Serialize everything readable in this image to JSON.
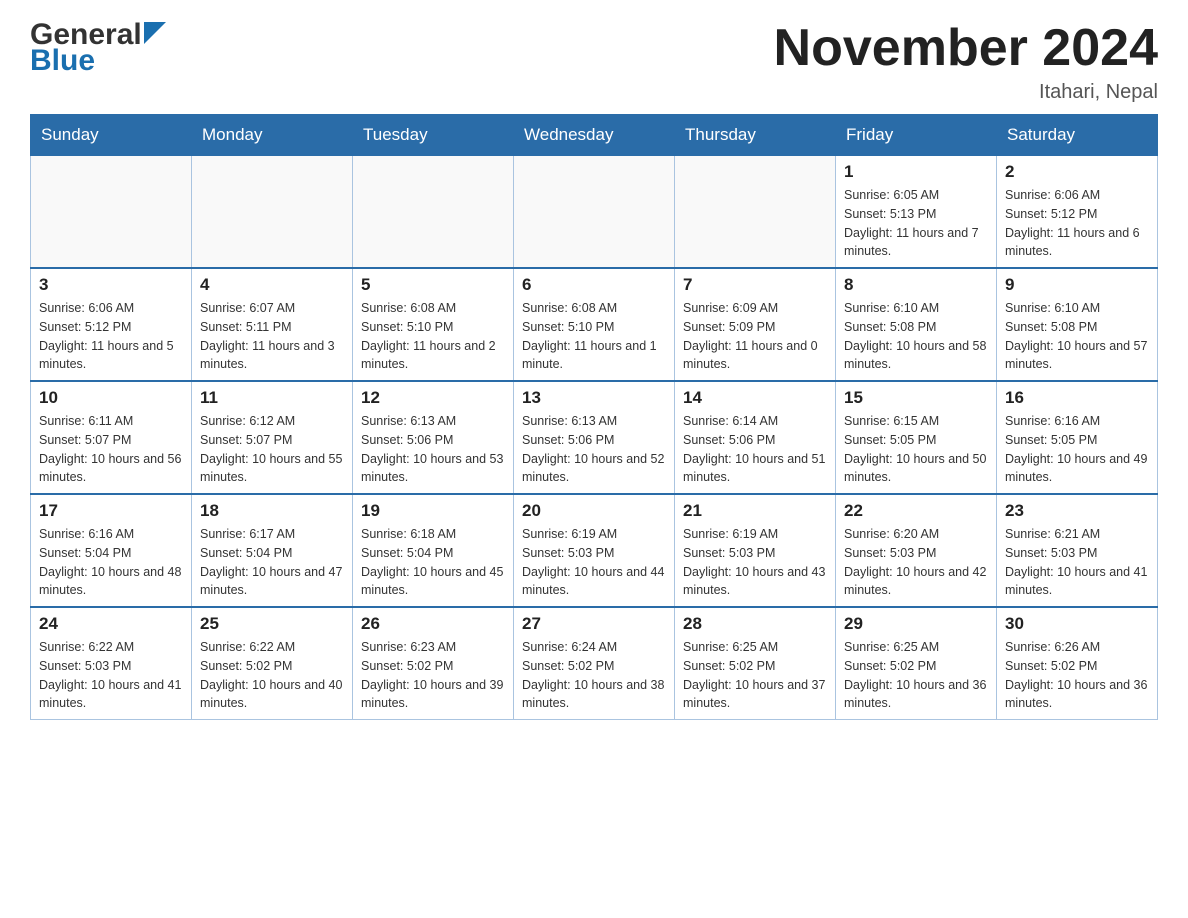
{
  "header": {
    "logo_general": "General",
    "logo_blue": "Blue",
    "month_title": "November 2024",
    "location": "Itahari, Nepal"
  },
  "days_of_week": [
    "Sunday",
    "Monday",
    "Tuesday",
    "Wednesday",
    "Thursday",
    "Friday",
    "Saturday"
  ],
  "weeks": [
    [
      {
        "day": "",
        "info": ""
      },
      {
        "day": "",
        "info": ""
      },
      {
        "day": "",
        "info": ""
      },
      {
        "day": "",
        "info": ""
      },
      {
        "day": "",
        "info": ""
      },
      {
        "day": "1",
        "info": "Sunrise: 6:05 AM\nSunset: 5:13 PM\nDaylight: 11 hours and 7 minutes."
      },
      {
        "day": "2",
        "info": "Sunrise: 6:06 AM\nSunset: 5:12 PM\nDaylight: 11 hours and 6 minutes."
      }
    ],
    [
      {
        "day": "3",
        "info": "Sunrise: 6:06 AM\nSunset: 5:12 PM\nDaylight: 11 hours and 5 minutes."
      },
      {
        "day": "4",
        "info": "Sunrise: 6:07 AM\nSunset: 5:11 PM\nDaylight: 11 hours and 3 minutes."
      },
      {
        "day": "5",
        "info": "Sunrise: 6:08 AM\nSunset: 5:10 PM\nDaylight: 11 hours and 2 minutes."
      },
      {
        "day": "6",
        "info": "Sunrise: 6:08 AM\nSunset: 5:10 PM\nDaylight: 11 hours and 1 minute."
      },
      {
        "day": "7",
        "info": "Sunrise: 6:09 AM\nSunset: 5:09 PM\nDaylight: 11 hours and 0 minutes."
      },
      {
        "day": "8",
        "info": "Sunrise: 6:10 AM\nSunset: 5:08 PM\nDaylight: 10 hours and 58 minutes."
      },
      {
        "day": "9",
        "info": "Sunrise: 6:10 AM\nSunset: 5:08 PM\nDaylight: 10 hours and 57 minutes."
      }
    ],
    [
      {
        "day": "10",
        "info": "Sunrise: 6:11 AM\nSunset: 5:07 PM\nDaylight: 10 hours and 56 minutes."
      },
      {
        "day": "11",
        "info": "Sunrise: 6:12 AM\nSunset: 5:07 PM\nDaylight: 10 hours and 55 minutes."
      },
      {
        "day": "12",
        "info": "Sunrise: 6:13 AM\nSunset: 5:06 PM\nDaylight: 10 hours and 53 minutes."
      },
      {
        "day": "13",
        "info": "Sunrise: 6:13 AM\nSunset: 5:06 PM\nDaylight: 10 hours and 52 minutes."
      },
      {
        "day": "14",
        "info": "Sunrise: 6:14 AM\nSunset: 5:06 PM\nDaylight: 10 hours and 51 minutes."
      },
      {
        "day": "15",
        "info": "Sunrise: 6:15 AM\nSunset: 5:05 PM\nDaylight: 10 hours and 50 minutes."
      },
      {
        "day": "16",
        "info": "Sunrise: 6:16 AM\nSunset: 5:05 PM\nDaylight: 10 hours and 49 minutes."
      }
    ],
    [
      {
        "day": "17",
        "info": "Sunrise: 6:16 AM\nSunset: 5:04 PM\nDaylight: 10 hours and 48 minutes."
      },
      {
        "day": "18",
        "info": "Sunrise: 6:17 AM\nSunset: 5:04 PM\nDaylight: 10 hours and 47 minutes."
      },
      {
        "day": "19",
        "info": "Sunrise: 6:18 AM\nSunset: 5:04 PM\nDaylight: 10 hours and 45 minutes."
      },
      {
        "day": "20",
        "info": "Sunrise: 6:19 AM\nSunset: 5:03 PM\nDaylight: 10 hours and 44 minutes."
      },
      {
        "day": "21",
        "info": "Sunrise: 6:19 AM\nSunset: 5:03 PM\nDaylight: 10 hours and 43 minutes."
      },
      {
        "day": "22",
        "info": "Sunrise: 6:20 AM\nSunset: 5:03 PM\nDaylight: 10 hours and 42 minutes."
      },
      {
        "day": "23",
        "info": "Sunrise: 6:21 AM\nSunset: 5:03 PM\nDaylight: 10 hours and 41 minutes."
      }
    ],
    [
      {
        "day": "24",
        "info": "Sunrise: 6:22 AM\nSunset: 5:03 PM\nDaylight: 10 hours and 41 minutes."
      },
      {
        "day": "25",
        "info": "Sunrise: 6:22 AM\nSunset: 5:02 PM\nDaylight: 10 hours and 40 minutes."
      },
      {
        "day": "26",
        "info": "Sunrise: 6:23 AM\nSunset: 5:02 PM\nDaylight: 10 hours and 39 minutes."
      },
      {
        "day": "27",
        "info": "Sunrise: 6:24 AM\nSunset: 5:02 PM\nDaylight: 10 hours and 38 minutes."
      },
      {
        "day": "28",
        "info": "Sunrise: 6:25 AM\nSunset: 5:02 PM\nDaylight: 10 hours and 37 minutes."
      },
      {
        "day": "29",
        "info": "Sunrise: 6:25 AM\nSunset: 5:02 PM\nDaylight: 10 hours and 36 minutes."
      },
      {
        "day": "30",
        "info": "Sunrise: 6:26 AM\nSunset: 5:02 PM\nDaylight: 10 hours and 36 minutes."
      }
    ]
  ]
}
